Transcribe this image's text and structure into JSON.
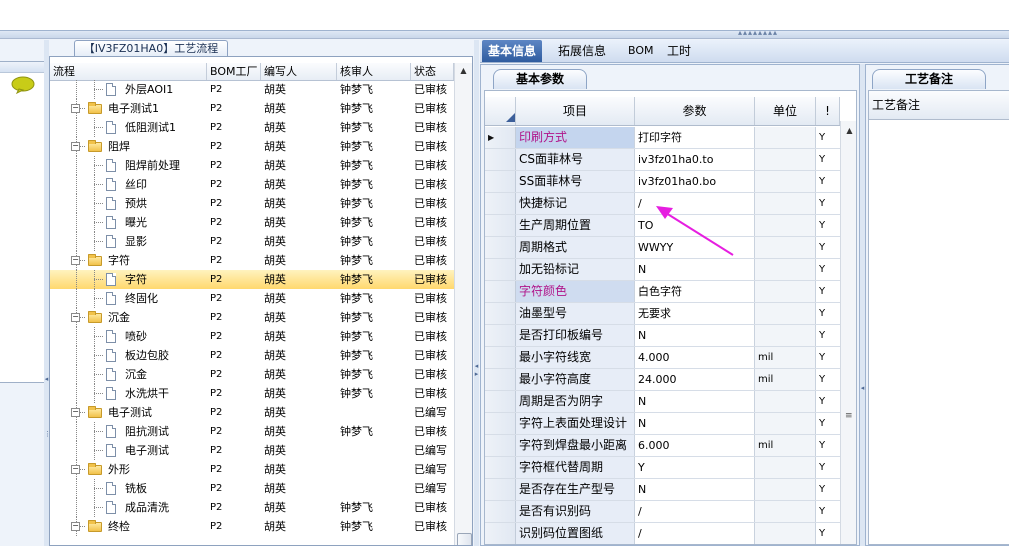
{
  "process_panel": {
    "title": "【IV3FZ01HA0】工艺流程",
    "columns": [
      "流程",
      "BOM工厂",
      "编写人",
      "核审人",
      "状态"
    ],
    "rows": [
      {
        "name": "外层AOI1",
        "type": "doc",
        "level": 2,
        "bom": "P2",
        "writer": "胡英",
        "reviewer": "钟梦飞",
        "status": "已审核"
      },
      {
        "name": "电子测试1",
        "type": "folder",
        "level": 1,
        "bom": "P2",
        "writer": "胡英",
        "reviewer": "钟梦飞",
        "status": "已审核"
      },
      {
        "name": "低阻测试1",
        "type": "doc",
        "level": 2,
        "bom": "P2",
        "writer": "胡英",
        "reviewer": "钟梦飞",
        "status": "已审核"
      },
      {
        "name": "阻焊",
        "type": "folder",
        "level": 1,
        "bom": "P2",
        "writer": "胡英",
        "reviewer": "钟梦飞",
        "status": "已审核"
      },
      {
        "name": "阻焊前处理",
        "type": "doc",
        "level": 2,
        "bom": "P2",
        "writer": "胡英",
        "reviewer": "钟梦飞",
        "status": "已审核"
      },
      {
        "name": "丝印",
        "type": "doc",
        "level": 2,
        "bom": "P2",
        "writer": "胡英",
        "reviewer": "钟梦飞",
        "status": "已审核"
      },
      {
        "name": "预烘",
        "type": "doc",
        "level": 2,
        "bom": "P2",
        "writer": "胡英",
        "reviewer": "钟梦飞",
        "status": "已审核"
      },
      {
        "name": "曝光",
        "type": "doc",
        "level": 2,
        "bom": "P2",
        "writer": "胡英",
        "reviewer": "钟梦飞",
        "status": "已审核"
      },
      {
        "name": "显影",
        "type": "doc",
        "level": 2,
        "bom": "P2",
        "writer": "胡英",
        "reviewer": "钟梦飞",
        "status": "已审核"
      },
      {
        "name": "字符",
        "type": "folder",
        "level": 1,
        "bom": "P2",
        "writer": "胡英",
        "reviewer": "钟梦飞",
        "status": "已审核"
      },
      {
        "name": "字符",
        "type": "doc",
        "level": 2,
        "bom": "P2",
        "writer": "胡英",
        "reviewer": "钟梦飞",
        "status": "已审核",
        "selected": true
      },
      {
        "name": "终固化",
        "type": "doc",
        "level": 2,
        "bom": "P2",
        "writer": "胡英",
        "reviewer": "钟梦飞",
        "status": "已审核"
      },
      {
        "name": "沉金",
        "type": "folder",
        "level": 1,
        "bom": "P2",
        "writer": "胡英",
        "reviewer": "钟梦飞",
        "status": "已审核"
      },
      {
        "name": "喷砂",
        "type": "doc",
        "level": 2,
        "bom": "P2",
        "writer": "胡英",
        "reviewer": "钟梦飞",
        "status": "已审核"
      },
      {
        "name": "板边包胶",
        "type": "doc",
        "level": 2,
        "bom": "P2",
        "writer": "胡英",
        "reviewer": "钟梦飞",
        "status": "已审核"
      },
      {
        "name": "沉金",
        "type": "doc",
        "level": 2,
        "bom": "P2",
        "writer": "胡英",
        "reviewer": "钟梦飞",
        "status": "已审核"
      },
      {
        "name": "水洗烘干",
        "type": "doc",
        "level": 2,
        "bom": "P2",
        "writer": "胡英",
        "reviewer": "钟梦飞",
        "status": "已审核"
      },
      {
        "name": "电子测试",
        "type": "folder",
        "level": 1,
        "bom": "P2",
        "writer": "胡英",
        "reviewer": "",
        "status": "已编写"
      },
      {
        "name": "阻抗测试",
        "type": "doc",
        "level": 2,
        "bom": "P2",
        "writer": "胡英",
        "reviewer": "钟梦飞",
        "status": "已审核"
      },
      {
        "name": "电子测试",
        "type": "doc",
        "level": 2,
        "bom": "P2",
        "writer": "胡英",
        "reviewer": "",
        "status": "已编写"
      },
      {
        "name": "外形",
        "type": "folder",
        "level": 1,
        "bom": "P2",
        "writer": "胡英",
        "reviewer": "",
        "status": "已编写"
      },
      {
        "name": "铣板",
        "type": "doc",
        "level": 2,
        "bom": "P2",
        "writer": "胡英",
        "reviewer": "",
        "status": "已编写"
      },
      {
        "name": "成品清洗",
        "type": "doc",
        "level": 2,
        "bom": "P2",
        "writer": "胡英",
        "reviewer": "钟梦飞",
        "status": "已审核"
      },
      {
        "name": "终检",
        "type": "folder",
        "level": 1,
        "bom": "P2",
        "writer": "胡英",
        "reviewer": "钟梦飞",
        "status": "已审核"
      }
    ]
  },
  "main_tabs": [
    "基本信息",
    "拓展信息",
    "BOM",
    "工时"
  ],
  "basic_params": {
    "tab_label": "基本参数",
    "columns": [
      "项目",
      "参数",
      "单位"
    ],
    "rows": [
      {
        "item": "印刷方式",
        "value": "打印字符",
        "unit": "",
        "flag": "Y",
        "highlight": true,
        "current": true
      },
      {
        "item": "CS面菲林号",
        "value": "iv3fz01ha0.to",
        "unit": "",
        "flag": "Y"
      },
      {
        "item": "SS面菲林号",
        "value": "iv3fz01ha0.bo",
        "unit": "",
        "flag": "Y"
      },
      {
        "item": "快捷标记",
        "value": "/",
        "unit": "",
        "flag": "Y"
      },
      {
        "item": "生产周期位置",
        "value": "TO",
        "unit": "",
        "flag": "Y"
      },
      {
        "item": "周期格式",
        "value": "WWYY",
        "unit": "",
        "flag": "Y"
      },
      {
        "item": "加无铅标记",
        "value": "N",
        "unit": "",
        "flag": "Y"
      },
      {
        "item": "字符颜色",
        "value": "白色字符",
        "unit": "",
        "flag": "Y",
        "highlight": true
      },
      {
        "item": "油墨型号",
        "value": "无要求",
        "unit": "",
        "flag": "Y"
      },
      {
        "item": "是否打印板编号",
        "value": "N",
        "unit": "",
        "flag": "Y"
      },
      {
        "item": "最小字符线宽",
        "value": "4.000",
        "unit": "mil",
        "flag": "Y"
      },
      {
        "item": "最小字符高度",
        "value": "24.000",
        "unit": "mil",
        "flag": "Y"
      },
      {
        "item": "周期是否为阴字",
        "value": "N",
        "unit": "",
        "flag": "Y"
      },
      {
        "item": "字符上表面处理设计",
        "value": "N",
        "unit": "",
        "flag": "Y"
      },
      {
        "item": "字符到焊盘最小距离",
        "value": "6.000",
        "unit": "mil",
        "flag": "Y"
      },
      {
        "item": "字符框代替周期",
        "value": "Y",
        "unit": "",
        "flag": "Y"
      },
      {
        "item": "是否存在生产型号",
        "value": "N",
        "unit": "",
        "flag": "Y"
      },
      {
        "item": "是否有识别码",
        "value": "/",
        "unit": "",
        "flag": "Y"
      },
      {
        "item": "识别码位置图纸",
        "value": "/",
        "unit": "",
        "flag": "Y"
      }
    ]
  },
  "notes": {
    "tab_label": "工艺备注",
    "header": "工艺备注"
  },
  "colors": {
    "accent_tab": "#2f5c9f",
    "highlight_text": "#b0148a",
    "selection": "#ffd86e",
    "annotation_arrow": "#e61ee0"
  }
}
